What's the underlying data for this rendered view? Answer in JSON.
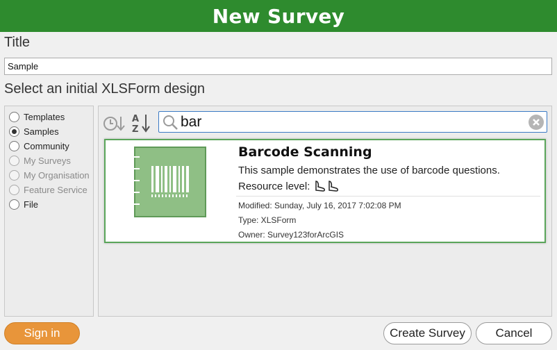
{
  "header": {
    "title": "New Survey"
  },
  "title_section": {
    "label": "Title",
    "value": "Sample"
  },
  "design_section": {
    "label": "Select an initial XLSForm design"
  },
  "sources": [
    {
      "label": "Templates",
      "checked": false,
      "disabled": false
    },
    {
      "label": "Samples",
      "checked": true,
      "disabled": false
    },
    {
      "label": "Community",
      "checked": false,
      "disabled": false
    },
    {
      "label": "My Surveys",
      "checked": false,
      "disabled": true
    },
    {
      "label": "My Organisation",
      "checked": false,
      "disabled": true
    },
    {
      "label": "Feature Service",
      "checked": false,
      "disabled": true
    },
    {
      "label": "File",
      "checked": false,
      "disabled": false
    }
  ],
  "search": {
    "value": "bar"
  },
  "result": {
    "title": "Barcode Scanning",
    "description": "This sample demonstrates the use of barcode questions.",
    "level_label": "Resource level:",
    "modified": "Modified: Sunday, July 16, 2017 7:02:08 PM",
    "type": "Type: XLSForm",
    "owner": "Owner: Survey123forArcGIS"
  },
  "buttons": {
    "sign_in": "Sign in",
    "create": "Create Survey",
    "cancel": "Cancel"
  },
  "colors": {
    "header": "#2e8b2e",
    "accent_green": "#5aa55a",
    "sign_in": "#e8953a",
    "search_border": "#3a79c4"
  },
  "icons": {
    "sort_by_date": "clock-sort-icon",
    "sort_alpha": "az-sort-icon",
    "search": "search-icon",
    "clear": "clear-icon",
    "thumbnail": "barcode-notebook-icon",
    "level": "footprints-icon"
  }
}
